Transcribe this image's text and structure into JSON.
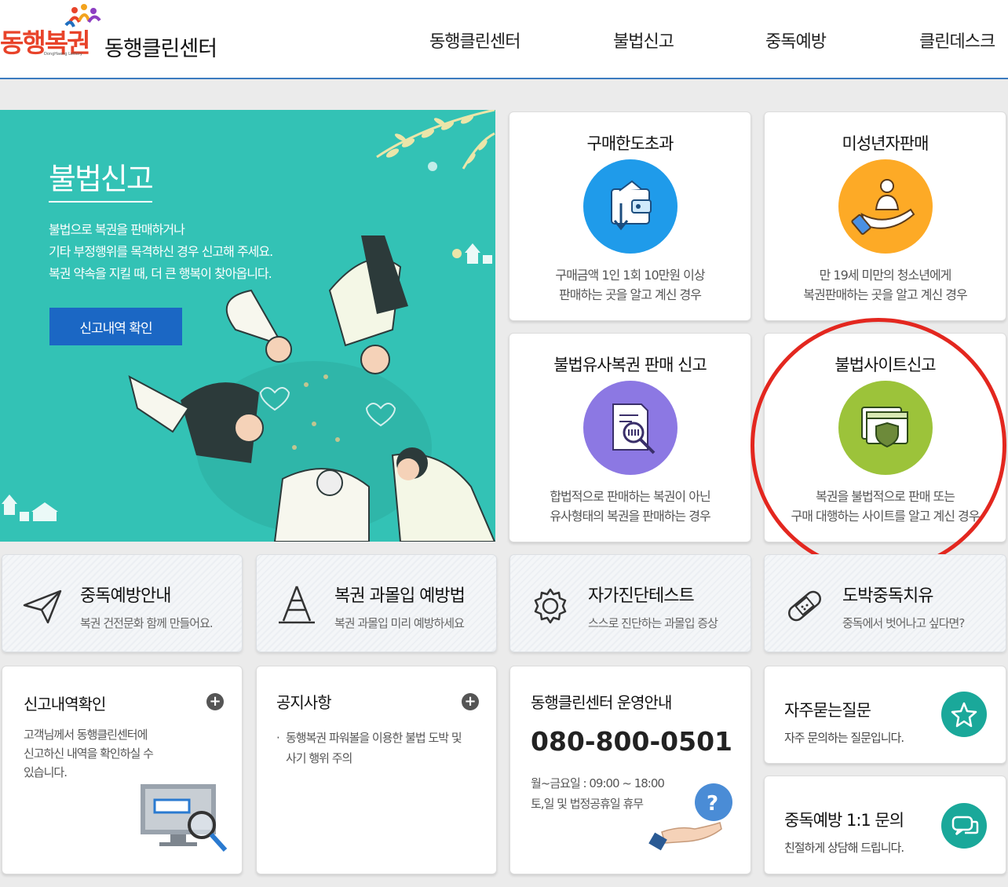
{
  "header": {
    "logo_text": "동행복권",
    "logo_sub": "DongHaeng Lottery",
    "site_title": "동행클린센터",
    "nav": [
      "동행클린센터",
      "불법신고",
      "중독예방",
      "클린데스크"
    ]
  },
  "hero": {
    "title": "불법신고",
    "desc_lines": [
      "불법으로 복권을 판매하거나",
      "기타 부정행위를 목격하신 경우 신고해 주세요.",
      "복권 약속을 지킬 때, 더 큰 행복이 찾아옵니다."
    ],
    "button": "신고내역 확인"
  },
  "report_cards": [
    {
      "title": "구매한도초과",
      "desc1": "구매금액 1인 1회 10만원 이상",
      "desc2": "판매하는 곳을 알고 계신 경우",
      "icon": "wallet-icon",
      "color": "#1f9bea"
    },
    {
      "title": "미성년자판매",
      "desc1": "만 19세 미만의 청소년에게",
      "desc2": "복권판매하는 곳을 알고 계신 경우",
      "icon": "hand-person-icon",
      "color": "#fdaa26"
    },
    {
      "title": "불법유사복권 판매 신고",
      "desc1": "합법적으로 판매하는 복권이 아닌",
      "desc2": "유사형태의 복권을 판매하는 경우",
      "icon": "document-search-icon",
      "color": "#8c78e3"
    },
    {
      "title": "불법사이트신고",
      "desc1": "복권을 불법적으로 판매 또는",
      "desc2": "구매 대행하는 사이트를 알고 계신 경우",
      "icon": "shield-window-icon",
      "color": "#9cc33a"
    }
  ],
  "tiles": [
    {
      "title": "중독예방안내",
      "sub": "복권 건전문화 함께 만들어요.",
      "icon": "paper-plane-icon"
    },
    {
      "title": "복권 과몰입 예방법",
      "sub": "복권 과몰입 미리 예방하세요",
      "icon": "cone-icon"
    },
    {
      "title": "자가진단테스트",
      "sub": "스스로 진단하는 과몰입 증상",
      "icon": "gear-icon"
    },
    {
      "title": "도박중독치유",
      "sub": "중독에서 벗어나고 싶다면?",
      "icon": "bandage-icon"
    }
  ],
  "bottom": {
    "report_history": {
      "title": "신고내역확인",
      "desc_lines": [
        "고객님께서 동행클린센터에",
        "신고하신 내역을 확인하실 수",
        "있습니다."
      ],
      "plus": "+"
    },
    "notice": {
      "title": "공지사항",
      "item_lines": [
        "동행복권 파워볼을 이용한 불법 도박 및",
        "사기 행위 주의"
      ],
      "plus": "+"
    },
    "operation": {
      "title": "동행클린센터 운영안내",
      "phone": "080-800-0501",
      "hours": "월~금요일 : 09:00 ~ 18:00",
      "closed": "토,일 및 법정공휴일 휴무"
    },
    "faq": {
      "title": "자주묻는질문",
      "sub": "자주 문의하는 질문입니다.",
      "icon": "star-icon"
    },
    "inquiry": {
      "title": "중독예방 1:1 문의",
      "sub": "친절하게 상담해 드립니다.",
      "icon": "chat-icon"
    }
  }
}
